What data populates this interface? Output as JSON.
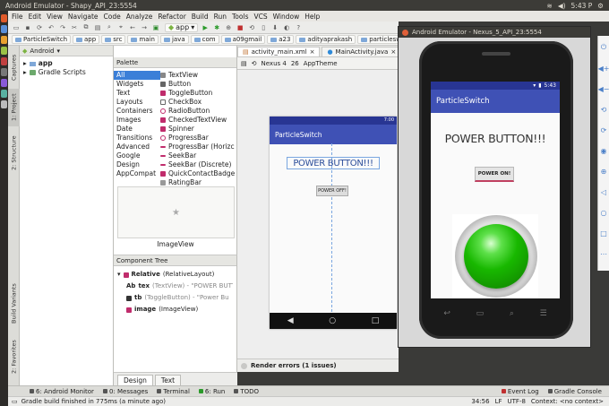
{
  "topbar": {
    "title": "Android Emulator - Shapy_API_23:5554",
    "time": "5:43 P"
  },
  "menu": [
    "File",
    "Edit",
    "View",
    "Navigate",
    "Code",
    "Analyze",
    "Refactor",
    "Build",
    "Run",
    "Tools",
    "VCS",
    "Window",
    "Help"
  ],
  "toolbar": {
    "run_config": "app"
  },
  "breadcrumbs": [
    "ParticleSwitch",
    "app",
    "src",
    "main",
    "java",
    "com",
    "a09gmail",
    "a23",
    "adityaprakash",
    "particleswitch"
  ],
  "left_tabs": {
    "captures": "Captures",
    "project": "1: Project",
    "structure": "2: Structure",
    "build_variants": "Build Variants",
    "favorites": "2: Favorites"
  },
  "project": {
    "dropdown": "Android",
    "items": [
      "app",
      "Gradle Scripts"
    ]
  },
  "palette": {
    "title": "Palette",
    "categories": [
      "All",
      "Widgets",
      "Text",
      "Layouts",
      "Containers",
      "Images",
      "Date",
      "Transitions",
      "Advanced",
      "Google",
      "Design",
      "AppCompat"
    ],
    "items": [
      "TextView",
      "Button",
      "ToggleButton",
      "CheckBox",
      "RadioButton",
      "CheckedTextView",
      "Spinner",
      "ProgressBar",
      "ProgressBar (Horizc",
      "SeekBar",
      "SeekBar (Discrete)",
      "QuickContactBadge",
      "RatingBar"
    ],
    "preview_label": "ImageView"
  },
  "component_tree": {
    "title": "Component Tree",
    "rows": [
      {
        "name": "Relative",
        "detail": "(RelativeLayout)"
      },
      {
        "name": "tex",
        "detail": "(TextView) - \"POWER BUTTON"
      },
      {
        "name": "tb",
        "detail": "(ToggleButton) - \"Power Bu"
      },
      {
        "name": "image",
        "detail": "(ImageView)"
      }
    ]
  },
  "design_tabs": [
    "Design",
    "Text"
  ],
  "editor_tabs": [
    "activity_main.xml",
    "MainActivity.java"
  ],
  "editor_toolbar": {
    "device": "Nexus 4",
    "api": "26",
    "theme": "AppTheme"
  },
  "design_preview": {
    "app_name": "ParticleSwitch",
    "time": "7:00",
    "title_text": "POWER BUTTON!!!",
    "button_text": "POWER OFF!"
  },
  "render_errors": "Render errors (1 issues)",
  "bottom_tools": [
    "6: Android Monitor",
    "0: Messages",
    "Terminal",
    "6: Run",
    "TODO",
    "Event Log",
    "Gradle Console"
  ],
  "statusbar": {
    "message": "Gradle build finished in 775ms (a minute ago)",
    "position": "34:56",
    "line_sep": "LF",
    "encoding": "UTF-8",
    "context": "Context: <no context>"
  },
  "emulator": {
    "window_title": "Android Emulator - Nexus_5_API_23:5554",
    "time": "5:43",
    "app_name": "ParticleSwitch",
    "title_text": "POWER BUTTON!!!",
    "button_text": "POWER ON!"
  }
}
